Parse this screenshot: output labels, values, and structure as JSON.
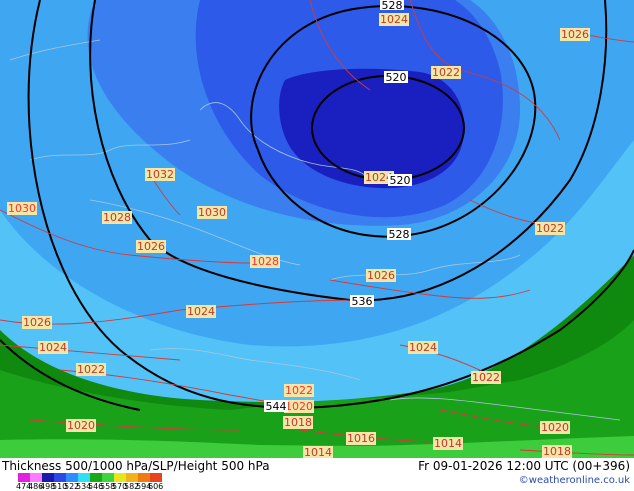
{
  "map": {
    "isobars": [
      {
        "label": "1024",
        "color": "#d43a3a"
      },
      {
        "label": "1026",
        "color": "#d43a3a"
      },
      {
        "label": "1022",
        "color": "#d43a3a"
      },
      {
        "label": "1032",
        "color": "#d43a3a"
      },
      {
        "label": "1030",
        "color": "#d43a3a"
      },
      {
        "label": "1028",
        "color": "#d43a3a"
      },
      {
        "label": "1020",
        "color": "#d43a3a"
      },
      {
        "label": "1018",
        "color": "#d43a3a"
      },
      {
        "label": "1016",
        "color": "#d43a3a"
      },
      {
        "label": "1014",
        "color": "#d43a3a"
      }
    ],
    "geopotential": [
      {
        "label": "528"
      },
      {
        "label": "520"
      },
      {
        "label": "536"
      },
      {
        "label": "544"
      }
    ]
  },
  "footer": {
    "title": "Thickness 500/1000 hPa/SLP/Height 500 hPa",
    "datetime": "Fr 09-01-2026 12:00 UTC (00+396)",
    "credit": "©weatheronline.co.uk",
    "legend": [
      {
        "value": "474",
        "color": "#e01fe0"
      },
      {
        "value": "486",
        "color": "#ff7bff"
      },
      {
        "value": "498",
        "color": "#1a1ab0"
      },
      {
        "value": "510",
        "color": "#2c48e6"
      },
      {
        "value": "522",
        "color": "#2f8cff"
      },
      {
        "value": "534",
        "color": "#2ee0f4"
      },
      {
        "value": "546",
        "color": "#18a818"
      },
      {
        "value": "558",
        "color": "#3dd43d"
      },
      {
        "value": "570",
        "color": "#e6e61a"
      },
      {
        "value": "582",
        "color": "#f0b41a"
      },
      {
        "value": "594",
        "color": "#f07a10"
      },
      {
        "value": "606",
        "color": "#e8421e"
      }
    ]
  }
}
